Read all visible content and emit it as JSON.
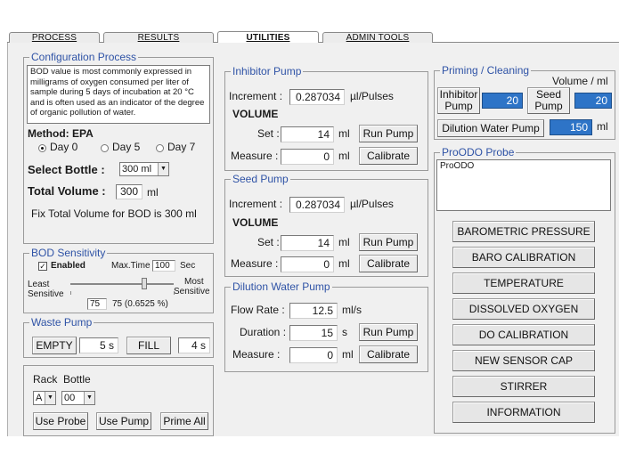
{
  "tabs": [
    {
      "label": "PROCESS"
    },
    {
      "label": "RESULTS"
    },
    {
      "label": "UTILITIES"
    },
    {
      "label": "ADMIN TOOLS"
    }
  ],
  "config": {
    "title": "Configuration Process",
    "description": "BOD value is most commonly expressed in milligrams of oxygen consumed per liter of sample during 5 days of incubation at 20 °C and is often used as an indicator of the degree of organic pollution of water.",
    "method_label": "Method: EPA",
    "radios": [
      "Day 0",
      "Day 5",
      "Day 7"
    ],
    "select_bottle_label": "Select Bottle :",
    "select_bottle_value": "300 ml",
    "total_volume_label": "Total Volume :",
    "total_volume_value": "300",
    "total_volume_unit": "ml",
    "fix_note": "Fix Total Volume for BOD is 300 ml"
  },
  "bod": {
    "title": "BOD Sensitivity",
    "enabled_label": "Enabled",
    "max_time_label": "Max.Time",
    "max_time_value": "100",
    "sec": "Sec",
    "least": "Least",
    "sensitive_left": "Sensitive",
    "most": "Most",
    "sensitive_right": "Sensitive",
    "slider_value": "75",
    "slider_text": "75 (0.6525 %)"
  },
  "waste": {
    "title": "Waste Pump",
    "empty": "EMPTY",
    "empty_value": "5",
    "empty_unit": "s",
    "fill": "FILL",
    "fill_value": "4",
    "fill_unit": "s"
  },
  "rack": {
    "rack_label": "Rack",
    "bottle_label": "Bottle",
    "rack_value": "A",
    "bottle_value": "00",
    "use_probe": "Use Probe",
    "use_pump": "Use Pump",
    "prime_all": "Prime All"
  },
  "inhibitor": {
    "title": "Inhibitor Pump",
    "increment_label": "Increment :",
    "increment_value": "0.287034",
    "increment_unit": "µl/Pulses",
    "volume_label": "VOLUME",
    "set_label": "Set :",
    "set_value": "14",
    "measure_label": "Measure :",
    "measure_value": "0",
    "unit": "ml",
    "run_pump": "Run Pump",
    "calibrate": "Calibrate"
  },
  "seed": {
    "title": "Seed Pump",
    "increment_label": "Increment :",
    "increment_value": "0.287034",
    "increment_unit": "µl/Pulses",
    "volume_label": "VOLUME",
    "set_label": "Set :",
    "set_value": "14",
    "measure_label": "Measure :",
    "measure_value": "0",
    "unit": "ml",
    "run_pump": "Run Pump",
    "calibrate": "Calibrate"
  },
  "dilution": {
    "title": "Dilution Water Pump",
    "flow_label": "Flow Rate :",
    "flow_value": "12.5",
    "flow_unit": "ml/s",
    "duration_label": "Duration :",
    "duration_value": "15",
    "duration_unit": "s",
    "measure_label": "Measure :",
    "measure_value": "0",
    "measure_unit": "ml",
    "run_pump": "Run Pump",
    "calibrate": "Calibrate"
  },
  "priming": {
    "title": "Priming / Cleaning",
    "volume_header": "Volume / ml",
    "inhibitor_btn_line1": "Inhibitor",
    "inhibitor_btn_line2": "Pump",
    "inhibitor_value": "20",
    "seed_btn_line1": "Seed",
    "seed_btn_line2": "Pump",
    "seed_value": "20",
    "dilution_btn": "Dilution Water Pump",
    "dilution_value": "150",
    "unit": "ml"
  },
  "probe": {
    "title": "ProODO Probe",
    "list_item": "ProODO",
    "buttons": [
      "BAROMETRIC PRESSURE",
      "BARO CALIBRATION",
      "TEMPERATURE",
      "DISSOLVED OXYGEN",
      "DO CALIBRATION",
      "NEW SENSOR CAP",
      "STIRRER",
      "INFORMATION"
    ]
  },
  "colors": {
    "legend": "#2f53a6",
    "highlight": "#2e74c7"
  }
}
